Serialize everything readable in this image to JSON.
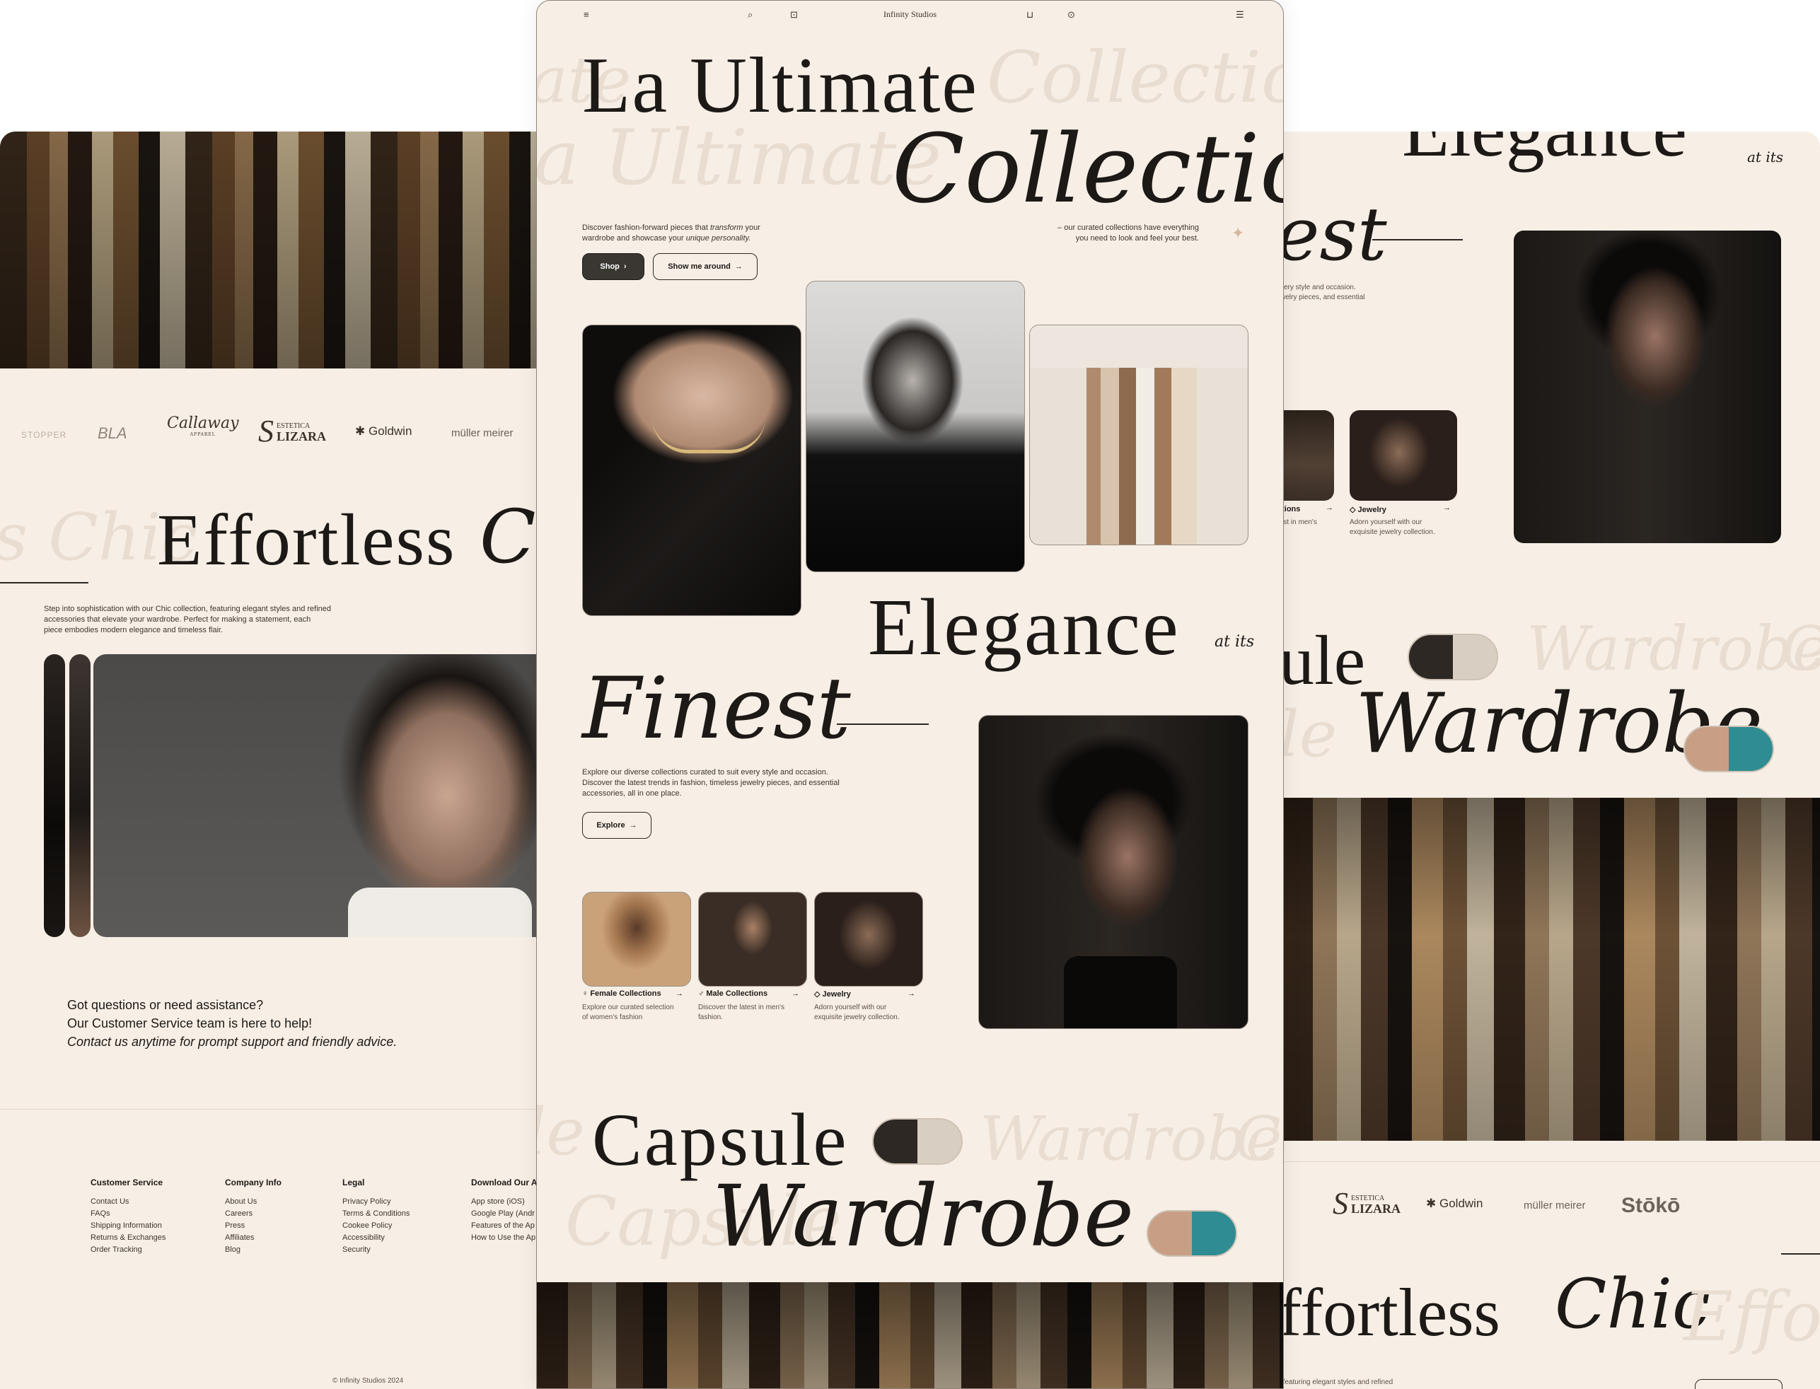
{
  "nav": {
    "brand": "Infinity Studios",
    "icons": [
      "menu-icon",
      "search-icon",
      "bag-icon",
      "cart-icon",
      "user-icon",
      "settings-icon"
    ]
  },
  "hero": {
    "title_line1": "La Ultimate",
    "title_script": "Collection",
    "ghost1": "Collection",
    "ghost2": "a Ultimate",
    "ghost3": "ate",
    "desc_a": "Discover fashion-forward pieces that ",
    "desc_b": "transform",
    "desc_c": " your",
    "desc_d": "wardrobe and showcase your ",
    "desc_e": "unique personality.",
    "right_l1": "– our curated collections have everything",
    "right_l2": "you need to look and feel your best.",
    "shop_label": "Shop",
    "tour_label": "Show me around"
  },
  "elegance": {
    "title": "Elegance",
    "at_its": "at its",
    "finest": "Finest",
    "desc_l1": "Explore our diverse collections curated to suit every style and occasion.",
    "desc_l2": "Discover the latest trends in fashion, timeless jewelry pieces, and essential",
    "desc_l3": "accessories, all in one place.",
    "explore_label": "Explore"
  },
  "categories": [
    {
      "title": "Female Collections",
      "desc_l1": "Explore our curated selection",
      "desc_l2": "of women's fashion"
    },
    {
      "title": "Male Collections",
      "desc_l1": "Discover the latest in men's",
      "desc_l2": "fashion."
    },
    {
      "title": "Jewelry",
      "desc_l1": "Adorn yourself with our",
      "desc_l2": "exquisite jewelry collection."
    }
  ],
  "capsule": {
    "title": "Capsule",
    "script": "Wardrobe",
    "ghost_a": "Wardrobe",
    "ghost_b": "Capsule",
    "ghost_c": "le",
    "ghost_d": "Ca"
  },
  "left": {
    "brands": [
      "STOPPER",
      "BLA",
      "Callaway",
      "ESTETICA",
      "LIZARA",
      "Goldwin",
      "müller meirer"
    ],
    "brand_sub": "APPAREL",
    "effortless": "Effortless",
    "chic": "Ch",
    "ghost_chic": "s Chic",
    "desc_l1": "Step into sophistication with our Chic collection, featuring elegant styles and refined",
    "desc_l2": "accessories that elevate your wardrobe. Perfect for making a statement, each",
    "desc_l3": "piece embodies modern elegance and timeless flair.",
    "support_l1": "Got questions or need assistance?",
    "support_l2": "Our Customer Service team is here to help!",
    "support_l3": "Contact us anytime for prompt support and friendly advice.",
    "footer": [
      {
        "heading": "Customer Service",
        "items": [
          "Contact Us",
          "FAQs",
          "Shipping Information",
          "Returns & Exchanges",
          "Order Tracking"
        ]
      },
      {
        "heading": "Company Info",
        "items": [
          "About Us",
          "Careers",
          "Press",
          "Affiliates",
          "Blog"
        ]
      },
      {
        "heading": "Legal",
        "items": [
          "Privacy Policy",
          "Terms & Conditions",
          "Cookee Policy",
          "Accessibility",
          "Security"
        ]
      },
      {
        "heading": "Download Our A",
        "items": [
          "App store (iOS)",
          "Google Play (Andr",
          "Features of the Ap",
          "How to Use the Ap"
        ]
      }
    ],
    "copyright": "© Infinity Studios 2024"
  },
  "right": {
    "elegance_cut": "Elegance",
    "at_its": "at its",
    "finest_cut": "est",
    "desc_l1": "very style and occasion.",
    "desc_l2": "welry pieces, and essential",
    "cat_cut_title": "ctions",
    "cat_cut_desc": "test in men's",
    "jewelry_title": "Jewelry",
    "jewelry_l1": "Adorn yourself with our",
    "jewelry_l2": "exquisite jewelry collection.",
    "capsule_cut": "ule",
    "ghost_w": "Wardrobe",
    "ghost_ca": "Ca",
    "ghost_le": "le",
    "wardrobe": "Wardrobe",
    "brands": [
      "ESTETICA",
      "LIZARA",
      "Goldwin",
      "müller meirer",
      "Stōkō"
    ],
    "effortless_cut": "ffortless",
    "chic": "Chic",
    "ghost_effort": "Effort",
    "bottom_desc": ", featuring elegant styles and refined"
  },
  "colors": {
    "bg": "#f7efe6",
    "ink": "#1c1916",
    "ghost": "#e9ddd1",
    "dark_button": "#2c2825"
  }
}
